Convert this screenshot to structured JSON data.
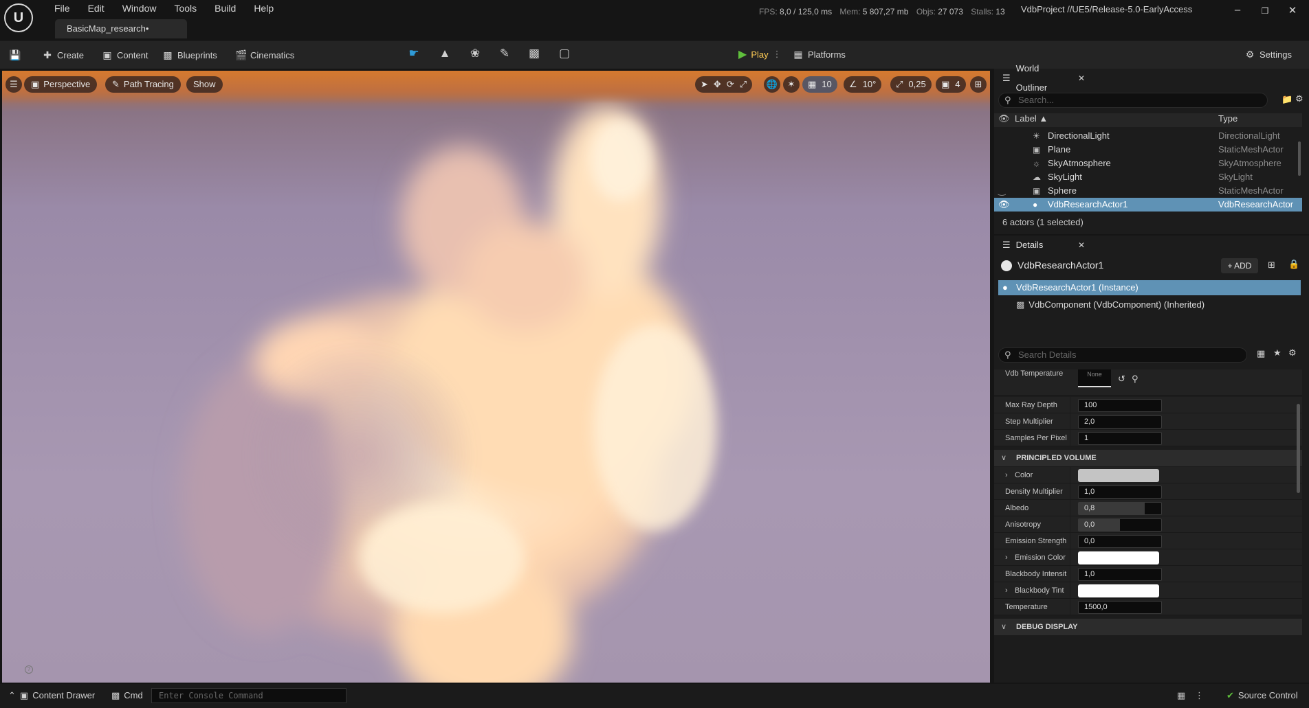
{
  "menu": [
    "File",
    "Edit",
    "Window",
    "Tools",
    "Build",
    "Help"
  ],
  "doc_tab": "BasicMap_research•",
  "stats": {
    "fps_label": "FPS:",
    "fps": "8,0",
    "frame_ms": "/ 125,0 ms",
    "mem_label": "Mem:",
    "mem": "5 807,27 mb",
    "objs_label": "Objs:",
    "objs": "27 073",
    "stalls_label": "Stalls:",
    "stalls": "13"
  },
  "project": "VdbProject //UE5/Release-5.0-EarlyAccess",
  "toolbar": {
    "create": "Create",
    "content": "Content",
    "blueprints": "Blueprints",
    "cinematics": "Cinematics",
    "play": "Play",
    "platforms": "Platforms",
    "settings": "Settings"
  },
  "viewport": {
    "perspective": "Perspective",
    "path_tracing": "Path Tracing",
    "show": "Show",
    "grid_snap": "10",
    "rot_snap": "10°",
    "scale_snap": "0,25",
    "cam_speed": "4"
  },
  "outliner": {
    "title": "World Outliner",
    "search_placeholder": "Search...",
    "col_label": "Label",
    "col_type": "Type",
    "rows": [
      {
        "label": "DirectionalLight",
        "type": "DirectionalLight",
        "icon": "directional-light-icon"
      },
      {
        "label": "Plane",
        "type": "StaticMeshActor",
        "icon": "static-mesh-icon"
      },
      {
        "label": "SkyAtmosphere",
        "type": "SkyAtmosphere",
        "icon": "sky-atmosphere-icon"
      },
      {
        "label": "SkyLight",
        "type": "SkyLight",
        "icon": "skylight-icon"
      },
      {
        "label": "Sphere",
        "type": "StaticMeshActor",
        "icon": "static-mesh-icon"
      },
      {
        "label": "VdbResearchActor1",
        "type": "VdbResearchActor",
        "icon": "actor-icon"
      }
    ],
    "status": "6 actors (1 selected)"
  },
  "details": {
    "title": "Details",
    "actor_name": "VdbResearchActor1",
    "add_label": "ADD",
    "instance": "VdbResearchActor1  (Instance)",
    "component": "VdbComponent (VdbComponent) (Inherited)",
    "search_placeholder": "Search Details",
    "vdb_temperature_label": "Vdb Temperature",
    "vdb_temperature_value": "None",
    "props": [
      {
        "label": "Max Ray Depth",
        "value": "100"
      },
      {
        "label": "Step Multiplier",
        "value": "2,0"
      },
      {
        "label": "Samples Per Pixel",
        "value": "1"
      }
    ],
    "section_principled": "PRINCIPLED VOLUME",
    "principled": {
      "color_label": "Color",
      "density_label": "Density Multiplier",
      "density_value": "1,0",
      "albedo_label": "Albedo",
      "albedo_value": "0,8",
      "albedo_fill": 0.8,
      "anisotropy_label": "Anisotropy",
      "anisotropy_value": "0,0",
      "anisotropy_fill": 0.5,
      "emission_strength_label": "Emission Strength",
      "emission_strength_value": "0,0",
      "emission_color_label": "Emission Color",
      "blackbody_intensity_label": "Blackbody Intensit",
      "blackbody_intensity_value": "1,0",
      "blackbody_tint_label": "Blackbody Tint",
      "temperature_label": "Temperature",
      "temperature_value": "1500,0",
      "color_swatch": "#c4c4c4",
      "emission_swatch": "#ffffff",
      "tint_swatch": "#ffffff"
    },
    "section_debug": "DEBUG DISPLAY"
  },
  "statusbar": {
    "content_drawer": "Content Drawer",
    "cmd": "Cmd",
    "console_placeholder": "Enter Console Command",
    "source_control": "Source Control"
  },
  "colors": {
    "selection": "#5f92b5",
    "play_green": "#5fbf3c",
    "select_blue": "#2f9bd8"
  }
}
